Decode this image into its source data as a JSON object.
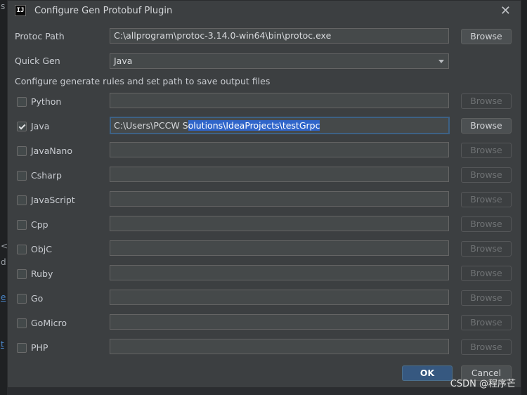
{
  "window": {
    "title": "Configure Gen Protobuf Plugin"
  },
  "protoc": {
    "label": "Protoc Path",
    "value": "C:\\allprogram\\protoc-3.14.0-win64\\bin\\protoc.exe",
    "browse": "Browse"
  },
  "quick_gen": {
    "label": "Quick Gen",
    "value": "Java"
  },
  "section_text": "Configure generate rules and set path to save output files",
  "rows": [
    {
      "name": "Python",
      "checked": false,
      "path": "",
      "browse": "Browse"
    },
    {
      "name": "Java",
      "checked": true,
      "path_pre": "C:\\Users\\PCCW S",
      "path_sel": "olutions\\IdeaProjects\\testGrpc",
      "browse": "Browse"
    },
    {
      "name": "JavaNano",
      "checked": false,
      "path": "",
      "browse": "Browse"
    },
    {
      "name": "Csharp",
      "checked": false,
      "path": "",
      "browse": "Browse"
    },
    {
      "name": "JavaScript",
      "checked": false,
      "path": "",
      "browse": "Browse"
    },
    {
      "name": "Cpp",
      "checked": false,
      "path": "",
      "browse": "Browse"
    },
    {
      "name": "ObjC",
      "checked": false,
      "path": "",
      "browse": "Browse"
    },
    {
      "name": "Ruby",
      "checked": false,
      "path": "",
      "browse": "Browse"
    },
    {
      "name": "Go",
      "checked": false,
      "path": "",
      "browse": "Browse"
    },
    {
      "name": "GoMicro",
      "checked": false,
      "path": "",
      "browse": "Browse"
    },
    {
      "name": "PHP",
      "checked": false,
      "path": "",
      "browse": "Browse"
    }
  ],
  "footer": {
    "ok": "OK",
    "cancel": "Cancel"
  },
  "watermark": "CSDN @程序芒",
  "background": {
    "frag_s": "s",
    "frag_lt": "<",
    "frag_d": "d",
    "frag_e": "e",
    "frag_t": "t"
  }
}
